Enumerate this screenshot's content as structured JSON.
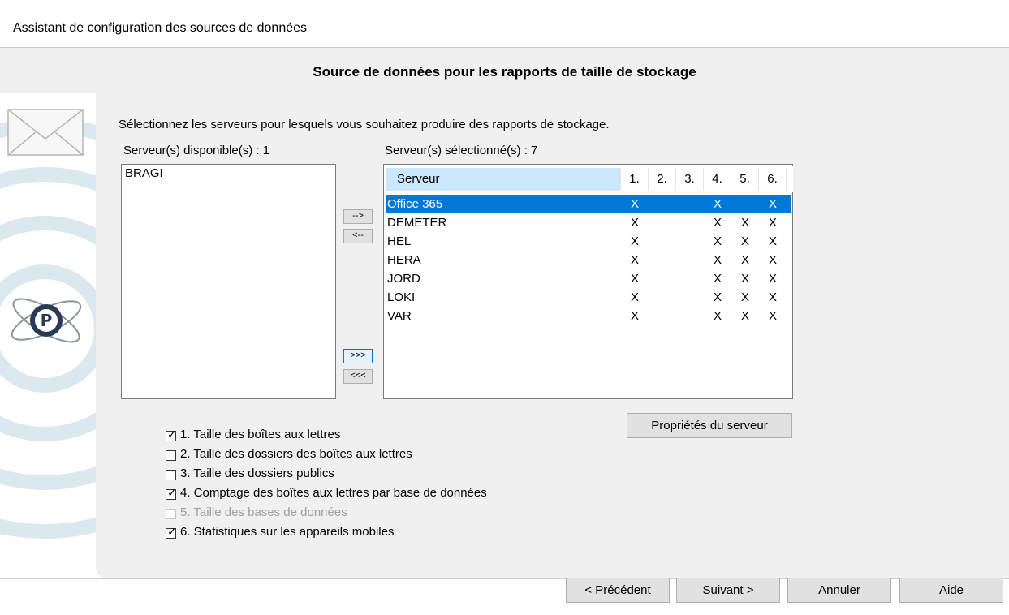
{
  "window": {
    "title": "Assistant de configuration des sources de données"
  },
  "header": {
    "title": "Source de données pour les rapports de taille de stockage"
  },
  "instructions": "Sélectionnez les serveurs pour lesquels vous souhaitez produire des rapports de stockage.",
  "available": {
    "label": "Serveur(s) disponible(s) : 1",
    "items": [
      "BRAGI"
    ]
  },
  "selected": {
    "label": "Serveur(s) sélectionné(s) : 7",
    "columns": [
      "Serveur",
      "1.",
      "2.",
      "3.",
      "4.",
      "5.",
      "6."
    ],
    "rows": [
      {
        "name": "Office 365",
        "c1": "X",
        "c2": "",
        "c3": "",
        "c4": "X",
        "c5": "",
        "c6": "X"
      },
      {
        "name": "DEMETER",
        "c1": "X",
        "c2": "",
        "c3": "",
        "c4": "X",
        "c5": "X",
        "c6": "X"
      },
      {
        "name": "HEL",
        "c1": "X",
        "c2": "",
        "c3": "",
        "c4": "X",
        "c5": "X",
        "c6": "X"
      },
      {
        "name": "HERA",
        "c1": "X",
        "c2": "",
        "c3": "",
        "c4": "X",
        "c5": "X",
        "c6": "X"
      },
      {
        "name": "JORD",
        "c1": "X",
        "c2": "",
        "c3": "",
        "c4": "X",
        "c5": "X",
        "c6": "X"
      },
      {
        "name": "LOKI",
        "c1": "X",
        "c2": "",
        "c3": "",
        "c4": "X",
        "c5": "X",
        "c6": "X"
      },
      {
        "name": "VAR",
        "c1": "X",
        "c2": "",
        "c3": "",
        "c4": "X",
        "c5": "X",
        "c6": "X"
      }
    ]
  },
  "transfer": {
    "add": "-->",
    "remove": "<--",
    "add_all": ">>>",
    "remove_all": "<<<"
  },
  "server_properties": "Propriétés du serveur",
  "options": [
    {
      "label": "1. Taille des boîtes aux lettres",
      "checked": true,
      "disabled": false
    },
    {
      "label": "2. Taille des dossiers des boîtes aux lettres",
      "checked": false,
      "disabled": false
    },
    {
      "label": "3. Taille des dossiers publics",
      "checked": false,
      "disabled": false
    },
    {
      "label": "4. Comptage des boîtes aux lettres par base de données",
      "checked": true,
      "disabled": false
    },
    {
      "label": "5. Taille des bases de données",
      "checked": false,
      "disabled": true
    },
    {
      "label": "6. Statistiques sur les appareils mobiles",
      "checked": true,
      "disabled": false
    }
  ],
  "footer": {
    "previous": "< Précédent",
    "next": "Suivant >",
    "cancel": "Annuler",
    "help": "Aide"
  },
  "colors": {
    "selection": "#0078d7",
    "header_sel": "#cce8ff",
    "panel": "#f0f0f0"
  }
}
